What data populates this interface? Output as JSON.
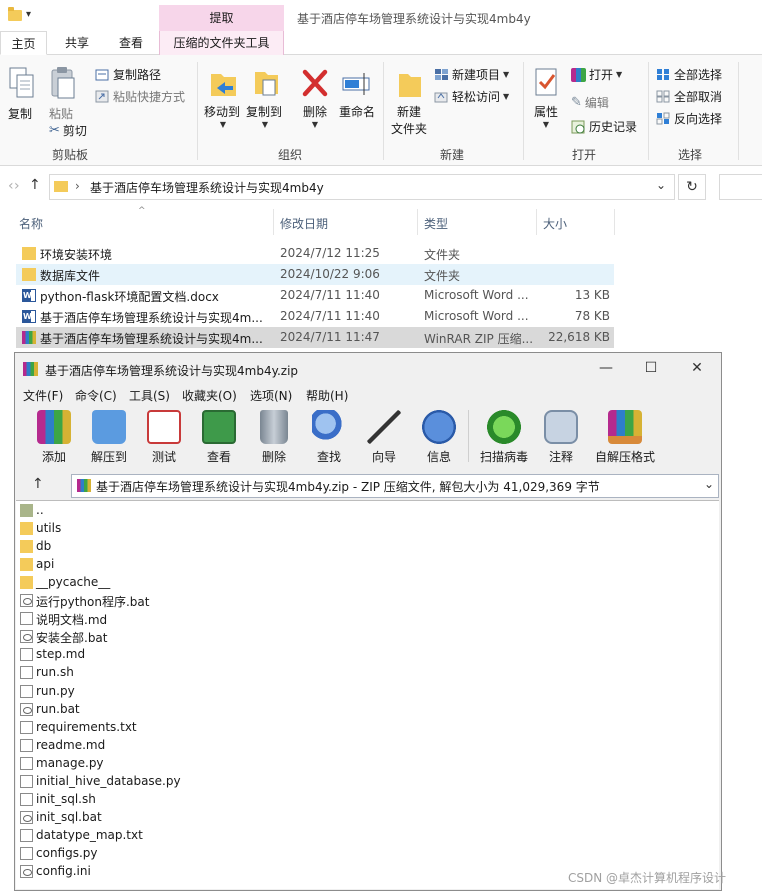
{
  "explorer": {
    "window_title": "基于酒店停车场管理系统设计与实现4mb4y",
    "qat_arrow": "▾",
    "context_tab_header": "提取",
    "tabs": [
      "主页",
      "共享",
      "查看",
      "压缩的文件夹工具"
    ],
    "ribbon": {
      "clipboard": {
        "group": "剪贴板",
        "copy": "复制",
        "paste": "粘贴",
        "copy_path": "复制路径",
        "paste_shortcut": "粘贴快捷方式",
        "cut": "剪切"
      },
      "organize": {
        "group": "组织",
        "move_to": "移动到",
        "copy_to": "复制到",
        "delete": "删除",
        "rename": "重命名"
      },
      "new": {
        "group": "新建",
        "new_folder_l1": "新建",
        "new_folder_l2": "文件夹",
        "new_item": "新建项目",
        "easy_access": "轻松访问"
      },
      "open": {
        "group": "打开",
        "properties": "属性",
        "open": "打开",
        "edit": "编辑",
        "history": "历史记录"
      },
      "select": {
        "group": "选择",
        "select_all": "全部选择",
        "select_none": "全部取消",
        "invert": "反向选择"
      }
    },
    "address": {
      "path": "基于酒店停车场管理系统设计与实现4mb4y",
      "back": "‹",
      "forward": "›",
      "up": "↑",
      "refresh": "↻"
    },
    "columns": [
      "名称",
      "修改日期",
      "类型",
      "大小"
    ],
    "files": [
      {
        "name": "环境安装环境",
        "date": "2024/7/12 11:25",
        "type": "文件夹",
        "size": "",
        "icon": "folder-icon"
      },
      {
        "name": "数据库文件",
        "date": "2024/10/22 9:06",
        "type": "文件夹",
        "size": "",
        "icon": "folder-icon"
      },
      {
        "name": "python-flask环境配置文档.docx",
        "date": "2024/7/11 11:40",
        "type": "Microsoft Word ...",
        "size": "13 KB",
        "icon": "word-icon"
      },
      {
        "name": "基于酒店停车场管理系统设计与实现4m...",
        "date": "2024/7/11 11:40",
        "type": "Microsoft Word ...",
        "size": "78 KB",
        "icon": "word-icon"
      },
      {
        "name": "基于酒店停车场管理系统设计与实现4m...",
        "date": "2024/7/11 11:47",
        "type": "WinRAR ZIP 压缩...",
        "size": "22,618 KB",
        "icon": "rar-icon"
      }
    ]
  },
  "winrar": {
    "title": "基于酒店停车场管理系统设计与实现4mb4y.zip",
    "controls": {
      "minimize": "—",
      "maximize": "☐",
      "close": "✕"
    },
    "menu": [
      "文件(F)",
      "命令(C)",
      "工具(S)",
      "收藏夹(O)",
      "选项(N)",
      "帮助(H)"
    ],
    "toolbar": [
      {
        "label": "添加",
        "icon": "add-archive-icon",
        "color": "#c84a3a"
      },
      {
        "label": "解压到",
        "icon": "extract-to-folder-icon",
        "color": "#4a8ad8"
      },
      {
        "label": "测试",
        "icon": "test-checklist-icon",
        "color": "#c83a3a"
      },
      {
        "label": "查看",
        "icon": "view-book-icon",
        "color": "#3e9a4a"
      },
      {
        "label": "删除",
        "icon": "trash-icon",
        "color": "#8e9aa6"
      },
      {
        "label": "查找",
        "icon": "find-magnifier-icon",
        "color": "#4a7ed0"
      },
      {
        "label": "向导",
        "icon": "wizard-wand-icon",
        "color": "#8a5ad0"
      },
      {
        "label": "信息",
        "icon": "info-icon",
        "color": "#3a6ec8"
      },
      {
        "label": "扫描病毒",
        "icon": "virus-scan-icon",
        "color": "#3aa63a"
      },
      {
        "label": "注释",
        "icon": "comment-icon",
        "color": "#7a8ea6"
      },
      {
        "label": "自解压格式",
        "icon": "sfx-box-icon",
        "color": "#d88a3a"
      }
    ],
    "path_text": "基于酒店停车场管理系统设计与实现4mb4y.zip - ZIP 压缩文件, 解包大小为 41,029,369 字节",
    "up": "↑",
    "dropdown": "⌄",
    "entries": [
      {
        "name": "..",
        "kind": "up"
      },
      {
        "name": "utils",
        "kind": "folder"
      },
      {
        "name": "db",
        "kind": "folder"
      },
      {
        "name": "api",
        "kind": "folder"
      },
      {
        "name": "__pycache__",
        "kind": "folder"
      },
      {
        "name": "运行python程序.bat",
        "kind": "bat"
      },
      {
        "name": "说明文档.md",
        "kind": "file"
      },
      {
        "name": "安装全部.bat",
        "kind": "bat"
      },
      {
        "name": "step.md",
        "kind": "file"
      },
      {
        "name": "run.sh",
        "kind": "file"
      },
      {
        "name": "run.py",
        "kind": "file"
      },
      {
        "name": "run.bat",
        "kind": "bat"
      },
      {
        "name": "requirements.txt",
        "kind": "file"
      },
      {
        "name": "readme.md",
        "kind": "file"
      },
      {
        "name": "manage.py",
        "kind": "file"
      },
      {
        "name": "initial_hive_database.py",
        "kind": "file"
      },
      {
        "name": "init_sql.sh",
        "kind": "file"
      },
      {
        "name": "init_sql.bat",
        "kind": "bat"
      },
      {
        "name": "datatype_map.txt",
        "kind": "file"
      },
      {
        "name": "configs.py",
        "kind": "file"
      },
      {
        "name": "config.ini",
        "kind": "bat"
      }
    ]
  },
  "watermark": "CSDN @卓杰计算机程序设计"
}
